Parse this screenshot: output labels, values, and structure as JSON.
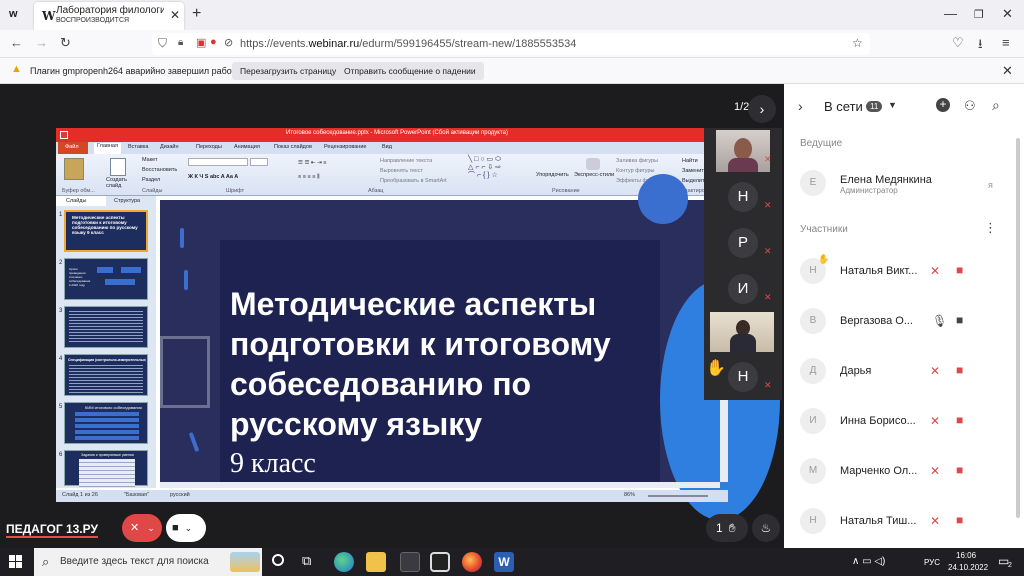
{
  "browser": {
    "tab_title": "Лаборатория филологическо",
    "tab_subtitle": "ВОСПРОИЗВОДИТСЯ",
    "tab_favicon": "W",
    "app_icon": "w",
    "url_prefix": "https://events.",
    "url_domain": "webinar.ru",
    "url_path": "/edurm/599196455/stream-new/1885553534"
  },
  "notification": {
    "text": "Плагин gmpropenh264 аварийно завершил работу.",
    "reload_label": "Перезагрузить страницу",
    "report_label": "Отправить сообщение о падении"
  },
  "presentation": {
    "window_title": "Итоговое собеседование.pptx - Microsoft PowerPoint (Сбой активации продукта)",
    "ribbon_tabs": [
      "Файл",
      "Главная",
      "Вставка",
      "Дизайн",
      "Переходы",
      "Анимация",
      "Показ слайдов",
      "Рецензирование",
      "Вид"
    ],
    "ribbon_groups": [
      "Буфер обм...",
      "Слайды",
      "Шрифт",
      "Абзац",
      "Рисование",
      "Редактиро..."
    ],
    "ribbon_items": [
      "Макет",
      "Восстановить",
      "Раздел",
      "Создать слайд",
      "Направление текста",
      "Выровнять текст",
      "Преобразовать в SmartArt",
      "Упорядочить",
      "Экспресс-стили",
      "Заливка фигуры",
      "Контур фигуры",
      "Эффекты фигуры",
      "Найти",
      "Заменить",
      "Выделить"
    ],
    "panel_tabs": [
      "Слайды",
      "Структура"
    ],
    "thumbs": [
      {
        "n": "1",
        "text": "Методические аспекты подготовки к итоговому собеседованию по русскому языку 9 класс"
      },
      {
        "n": "2",
        "text": "Сроки проведения итогового собеседования в 2022 году"
      },
      {
        "n": "3",
        "text": ""
      },
      {
        "n": "4",
        "text": "Спецификация (контрольно-измерительных) задач"
      },
      {
        "n": "5",
        "text": "КИМ итогового собеседования"
      },
      {
        "n": "6",
        "text": "Задания и проверяемые умения"
      }
    ],
    "slide_title": "Методические аспекты подготовки к итоговому собеседованию по русскому языку",
    "slide_subtitle": "9 класс",
    "status": {
      "slide": "Слайд 1 из 26",
      "theme": "\"Базовая\"",
      "lang": "русский",
      "zoom": "86%"
    }
  },
  "page_indicator": "1/2",
  "brand": "ПЕДАГОГ 13.РУ",
  "hands_count": "1",
  "video_tiles": [
    {
      "letter": "",
      "type": "video"
    },
    {
      "letter": "Н",
      "type": "avatar"
    },
    {
      "letter": "Р",
      "type": "avatar"
    },
    {
      "letter": "И",
      "type": "avatar"
    },
    {
      "letter": "",
      "type": "video"
    },
    {
      "letter": "Н",
      "type": "avatar",
      "hand": true
    }
  ],
  "panel": {
    "online_label": "В сети",
    "online_count": "11",
    "hosts_label": "Ведущие",
    "host": {
      "initial": "Е",
      "name": "Елена Медянкина",
      "role": "Администратор",
      "me": "я"
    },
    "participants_label": "Участники",
    "participants": [
      {
        "initial": "Н",
        "name": "Наталья Викт...",
        "hand": true
      },
      {
        "initial": "В",
        "name": "Вергазова О..."
      },
      {
        "initial": "Д",
        "name": "Дарья"
      },
      {
        "initial": "И",
        "name": "Инна Борисо..."
      },
      {
        "initial": "М",
        "name": "Марченко Ол..."
      },
      {
        "initial": "Н",
        "name": "Наталья Тиш..."
      }
    ]
  },
  "taskbar": {
    "search_placeholder": "Введите здесь текст для поиска",
    "lang": "РУС",
    "time": "16:06",
    "date": "24.10.2022",
    "notif_count": "2"
  }
}
